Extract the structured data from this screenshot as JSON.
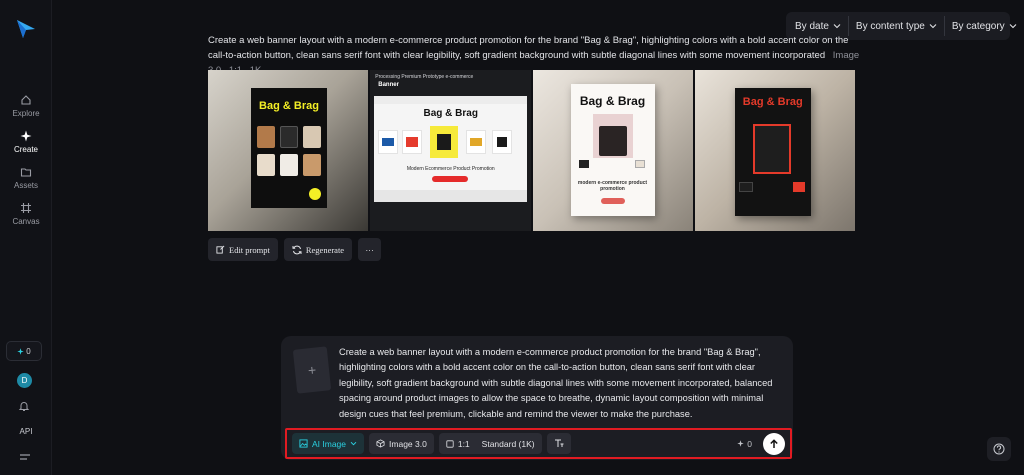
{
  "sidebar": {
    "items": [
      {
        "label": "Explore",
        "icon": "home-icon"
      },
      {
        "label": "Create",
        "icon": "sparkle-icon"
      },
      {
        "label": "Assets",
        "icon": "folder-icon"
      },
      {
        "label": "Canvas",
        "icon": "frame-icon"
      }
    ],
    "credits": "0",
    "avatar_initial": "D",
    "api_label": "API"
  },
  "filters": [
    {
      "label": "By date"
    },
    {
      "label": "By content type"
    },
    {
      "label": "By category"
    }
  ],
  "generation": {
    "prompt": "Create a web banner layout with a modern e-commerce product promotion for the brand \"Bag & Brag\", highlighting colors with a bold accent color on the call-to-action button, clean sans serif font with clear legibility, soft gradient background with subtle diagonal lines with some movement incorporated",
    "model": "Image 3.0",
    "ratio": "1:1",
    "resolution": "1K",
    "images": {
      "brand": "Bag & Brag",
      "banner_header": "Processing Premium Prototype e-commerce",
      "banner_tab": "Banner",
      "promo_line": "Modern Ecommerce Product Promotion",
      "promo_line_2": "modern e-commerce product promotion"
    }
  },
  "actions": {
    "edit": "Edit prompt",
    "regenerate": "Regenerate",
    "more": "···"
  },
  "composer": {
    "prompt": "Create a web banner layout with a modern e-commerce product promotion for the brand \"Bag & Brag\", highlighting colors with a bold accent color on the call-to-action button, clean sans serif font with clear legibility, soft gradient background with subtle diagonal lines with some movement incorporated, balanced spacing around product images to allow the space to breathe, dynamic layout composition with minimal design cues that feel premium, clickable and remind the viewer to make the purchase.",
    "mode": "AI Image",
    "model": "Image 3.0",
    "ratio": "1:1",
    "quality": "Standard (1K)",
    "cost": "0"
  },
  "colors": {
    "accent": "#2ad0e0",
    "highlight_border": "#e11b22",
    "brand_yellow": "#f4ef26"
  }
}
